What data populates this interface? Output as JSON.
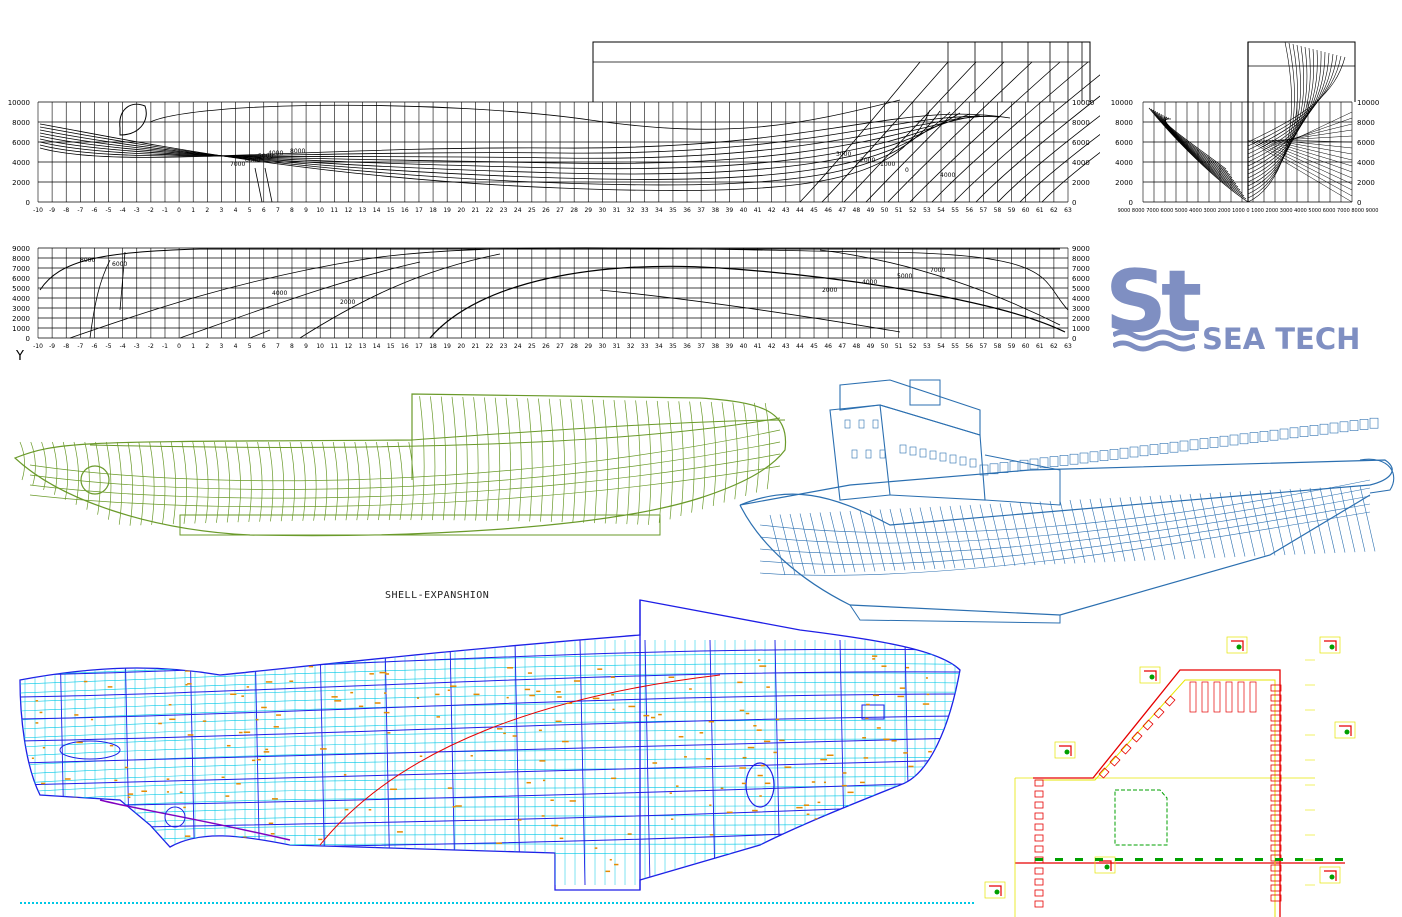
{
  "profile_yaxis_labels": [
    "10000",
    "8000",
    "6000",
    "4000",
    "2000",
    "0"
  ],
  "profile_inline_labels": [
    "8000",
    "7000",
    "6000",
    "5000",
    "4000",
    "3000",
    "2000",
    "1000",
    "0",
    "4000"
  ],
  "plan_yaxis_labels": [
    "9000",
    "8000",
    "7000",
    "6000",
    "5000",
    "4000",
    "3000",
    "2000",
    "1000",
    "0"
  ],
  "plan_inline_labels": [
    "8000",
    "6000",
    "4000",
    "2000",
    "2000",
    "4000",
    "5000",
    "7000"
  ],
  "plan_y_marker": "Y",
  "frame_numbers": [
    "-10",
    "-9",
    "-8",
    "-7",
    "-6",
    "-5",
    "-4",
    "-3",
    "-2",
    "-1",
    "0",
    "1",
    "2",
    "3",
    "4",
    "5",
    "6",
    "7",
    "8",
    "9",
    "10",
    "11",
    "12",
    "13",
    "14",
    "15",
    "16",
    "17",
    "18",
    "19",
    "20",
    "21",
    "22",
    "23",
    "24",
    "25",
    "26",
    "27",
    "28",
    "29",
    "30",
    "31",
    "32",
    "33",
    "34",
    "35",
    "36",
    "37",
    "38",
    "39",
    "40",
    "41",
    "42",
    "43",
    "44",
    "45",
    "46",
    "47",
    "48",
    "49",
    "50",
    "51",
    "52",
    "53",
    "54",
    "55",
    "56",
    "57",
    "58",
    "59",
    "60",
    "61",
    "62",
    "63"
  ],
  "body_plan_yaxis_labels": [
    "10000",
    "8000",
    "6000",
    "4000",
    "2000",
    "0"
  ],
  "body_plan_xaxis_label": "9000 8000 7000 6000 5000 4000 3000 2000 1000 0 1000 2000 3000 4000 5000 6000 7000 8000 9000",
  "logo": {
    "mark": "St",
    "name": "SEA TECH",
    "color": "#7f8fc2"
  },
  "shell_expansion_caption": "SHELL-EXPANSHION",
  "colors": {
    "lines_plan": "#000000",
    "wireframe": "#6a9a2a",
    "model_3d": "#2b6fb0",
    "shell_blue": "#1e1ee6",
    "shell_cyan": "#00c8e6",
    "detail_yellow": "#e6e600",
    "detail_red": "#e60000",
    "detail_green": "#00a000"
  }
}
